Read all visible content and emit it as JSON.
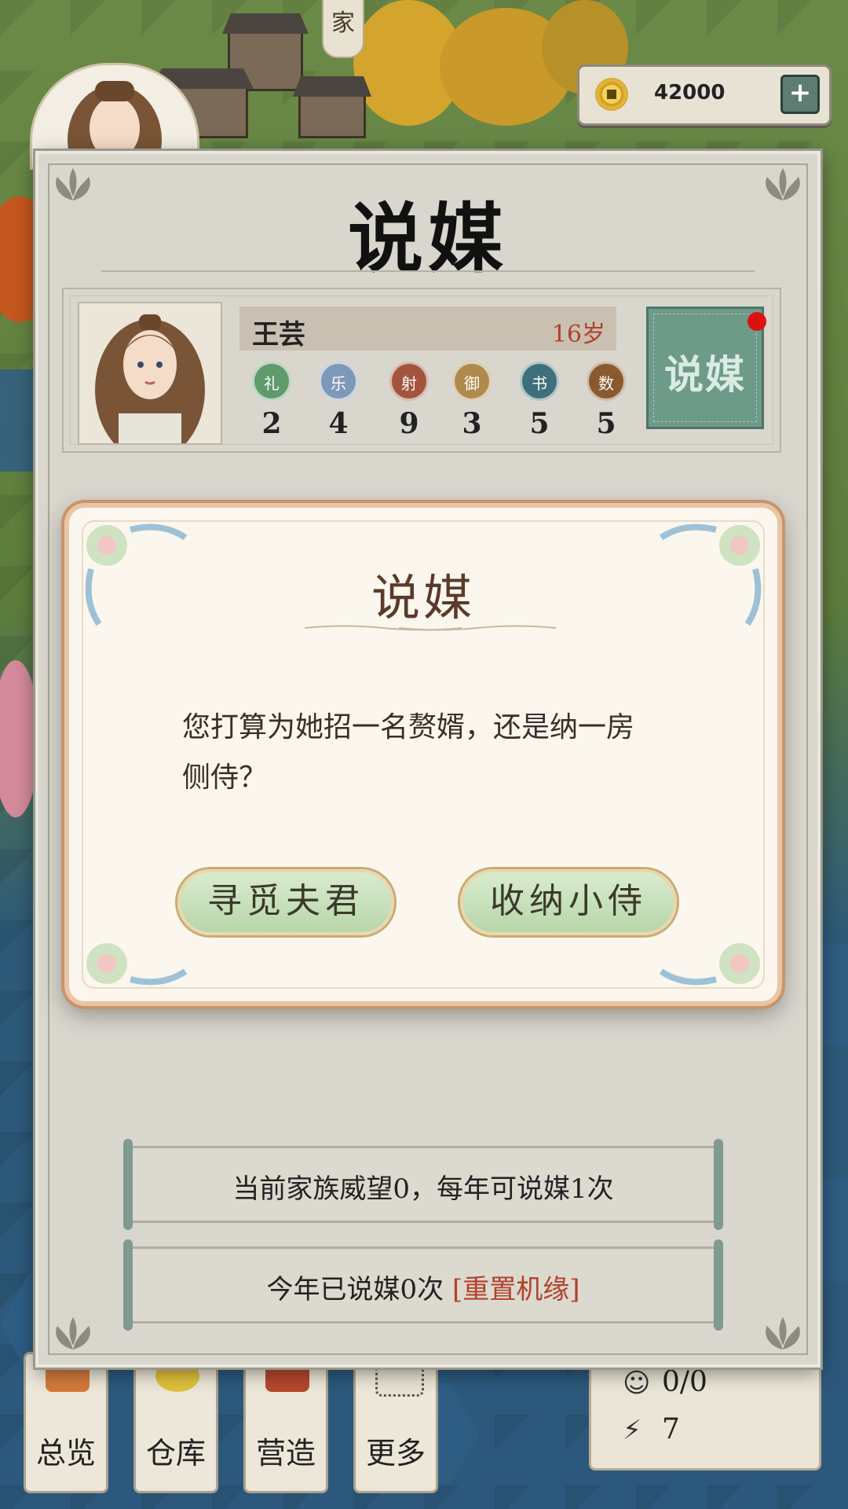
{
  "header": {
    "family_tab": "家",
    "coins": "42000",
    "coin_add": "+"
  },
  "dialog": {
    "title": "说媒",
    "character": {
      "name": "王芸",
      "age": "16岁",
      "stats": [
        {
          "label": "礼",
          "value": "2",
          "color": "#5f9a6a"
        },
        {
          "label": "乐",
          "value": "4",
          "color": "#7d98b8"
        },
        {
          "label": "射",
          "value": "9",
          "color": "#a4533d"
        },
        {
          "label": "御",
          "value": "3",
          "color": "#b0894d"
        },
        {
          "label": "书",
          "value": "5",
          "color": "#3f6f7a"
        },
        {
          "label": "数",
          "value": "5",
          "color": "#8a5a2e"
        }
      ]
    },
    "match_button": "说媒",
    "info_prestige": "当前家族威望0，每年可说媒1次",
    "info_used": "今年已说媒0次",
    "info_reset": "[重置机缘]"
  },
  "modal": {
    "title": "说媒",
    "message": "您打算为她招一名赘婿，还是纳一房侧侍？",
    "option_husband": "寻觅夫君",
    "option_attendant": "收纳小侍"
  },
  "bottom_nav": [
    {
      "label": "总览"
    },
    {
      "label": "仓库"
    },
    {
      "label": "营造"
    },
    {
      "label": "更多"
    }
  ],
  "population": {
    "people": "0/0",
    "energy": "7"
  }
}
